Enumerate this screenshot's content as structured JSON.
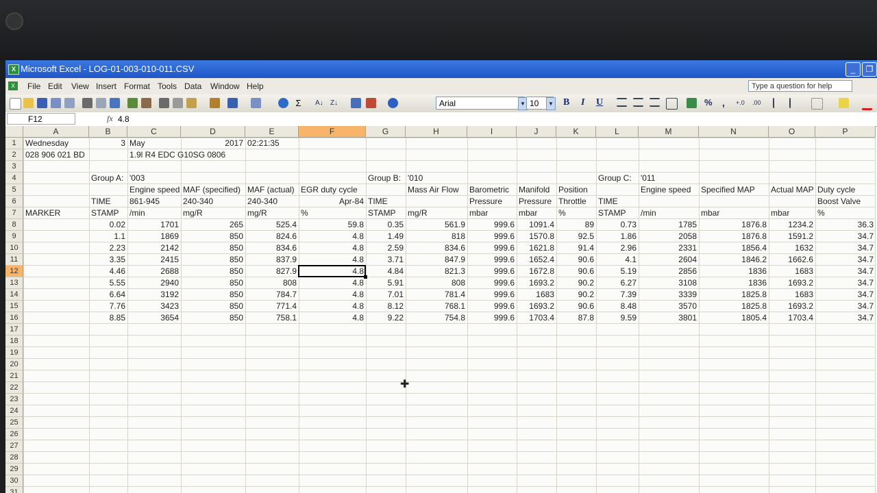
{
  "window": {
    "title": "Microsoft Excel - LOG-01-003-010-011.CSV",
    "app_icon": "excel-icon"
  },
  "menu": [
    "File",
    "Edit",
    "View",
    "Insert",
    "Format",
    "Tools",
    "Data",
    "Window",
    "Help"
  ],
  "help_placeholder": "Type a question for help",
  "toolbar": {
    "font": "Arial",
    "size": "10",
    "bold": "B",
    "italic": "I",
    "underline": "U",
    "percent": "%",
    "comma": ","
  },
  "formula_bar": {
    "name_box": "F12",
    "fx": "fx",
    "value": "4.8"
  },
  "columns": [
    {
      "id": "A",
      "w": 96
    },
    {
      "id": "B",
      "w": 56
    },
    {
      "id": "C",
      "w": 78
    },
    {
      "id": "D",
      "w": 94
    },
    {
      "id": "E",
      "w": 78
    },
    {
      "id": "F",
      "w": 98
    },
    {
      "id": "G",
      "w": 58
    },
    {
      "id": "H",
      "w": 90
    },
    {
      "id": "I",
      "w": 72
    },
    {
      "id": "J",
      "w": 58
    },
    {
      "id": "K",
      "w": 58
    },
    {
      "id": "L",
      "w": 62
    },
    {
      "id": "M",
      "w": 88
    },
    {
      "id": "N",
      "w": 102
    },
    {
      "id": "O",
      "w": 68
    },
    {
      "id": "P",
      "w": 88
    }
  ],
  "rows": [
    "1",
    "2",
    "3",
    "4",
    "5",
    "6",
    "7",
    "8",
    "9",
    "10",
    "11",
    "12",
    "13",
    "14",
    "15",
    "16",
    "17",
    "18",
    "19",
    "20",
    "21",
    "22",
    "23",
    "24",
    "25",
    "26",
    "27",
    "28",
    "29",
    "30",
    "31",
    "32"
  ],
  "selected": {
    "col": "F",
    "row": "12"
  },
  "cells": [
    [
      "Wednesday",
      "3",
      "May",
      "2017",
      "02:21:35",
      "",
      "",
      "",
      "",
      "",
      "",
      "",
      "",
      "",
      "",
      ""
    ],
    [
      "028 906 021 BD",
      "",
      "1.9l R4 EDC  G10SG  0806",
      "",
      "",
      "",
      "",
      "",
      "",
      "",
      "",
      "",
      "",
      "",
      "",
      ""
    ],
    [
      "",
      "",
      "",
      "",
      "",
      "",
      "",
      "",
      "",
      "",
      "",
      "",
      "",
      "",
      "",
      ""
    ],
    [
      "",
      "Group A:",
      "'003",
      "",
      "",
      "",
      "Group B:",
      "'010",
      "",
      "",
      "",
      "Group C:",
      "'011",
      "",
      "",
      ""
    ],
    [
      "",
      "",
      "Engine speed",
      "MAF (specified)",
      "MAF (actual)",
      "EGR duty cycle",
      "",
      "Mass Air Flow",
      "Barometric",
      "Manifold",
      "Position",
      "",
      "Engine speed",
      "Specified MAP",
      "Actual MAP",
      "Duty cycle"
    ],
    [
      "",
      "TIME",
      "861-945",
      "240-340",
      "240-340",
      "Apr-84",
      "TIME",
      "",
      "Pressure",
      "Pressure",
      "Throttle",
      "TIME",
      "",
      "",
      "",
      "Boost Valve"
    ],
    [
      "MARKER",
      "STAMP",
      "/min",
      "mg/R",
      "mg/R",
      "%",
      "STAMP",
      "mg/R",
      "mbar",
      "mbar",
      "%",
      "STAMP",
      "/min",
      "mbar",
      "mbar",
      "%"
    ],
    [
      "",
      "0.02",
      "1701",
      "265",
      "525.4",
      "59.8",
      "0.35",
      "561.9",
      "999.6",
      "1091.4",
      "89",
      "0.73",
      "1785",
      "1876.8",
      "1234.2",
      "36.3"
    ],
    [
      "",
      "1.1",
      "1869",
      "850",
      "824.6",
      "4.8",
      "1.49",
      "818",
      "999.6",
      "1570.8",
      "92.5",
      "1.86",
      "2058",
      "1876.8",
      "1591.2",
      "34.7"
    ],
    [
      "",
      "2.23",
      "2142",
      "850",
      "834.6",
      "4.8",
      "2.59",
      "834.6",
      "999.6",
      "1621.8",
      "91.4",
      "2.96",
      "2331",
      "1856.4",
      "1632",
      "34.7"
    ],
    [
      "",
      "3.35",
      "2415",
      "850",
      "837.9",
      "4.8",
      "3.71",
      "847.9",
      "999.6",
      "1652.4",
      "90.6",
      "4.1",
      "2604",
      "1846.2",
      "1662.6",
      "34.7"
    ],
    [
      "",
      "4.46",
      "2688",
      "850",
      "827.9",
      "4.8",
      "4.84",
      "821.3",
      "999.6",
      "1672.8",
      "90.6",
      "5.19",
      "2856",
      "1836",
      "1683",
      "34.7"
    ],
    [
      "",
      "5.55",
      "2940",
      "850",
      "808",
      "4.8",
      "5.91",
      "808",
      "999.6",
      "1693.2",
      "90.2",
      "6.27",
      "3108",
      "1836",
      "1693.2",
      "34.7"
    ],
    [
      "",
      "6.64",
      "3192",
      "850",
      "784.7",
      "4.8",
      "7.01",
      "781.4",
      "999.6",
      "1683",
      "90.2",
      "7.39",
      "3339",
      "1825.8",
      "1683",
      "34.7"
    ],
    [
      "",
      "7.76",
      "3423",
      "850",
      "771.4",
      "4.8",
      "8.12",
      "768.1",
      "999.6",
      "1693.2",
      "90.6",
      "8.48",
      "3570",
      "1825.8",
      "1693.2",
      "34.7"
    ],
    [
      "",
      "8.85",
      "3654",
      "850",
      "758.1",
      "4.8",
      "9.22",
      "754.8",
      "999.6",
      "1703.4",
      "87.8",
      "9.59",
      "3801",
      "1805.4",
      "1703.4",
      "34.7"
    ]
  ]
}
